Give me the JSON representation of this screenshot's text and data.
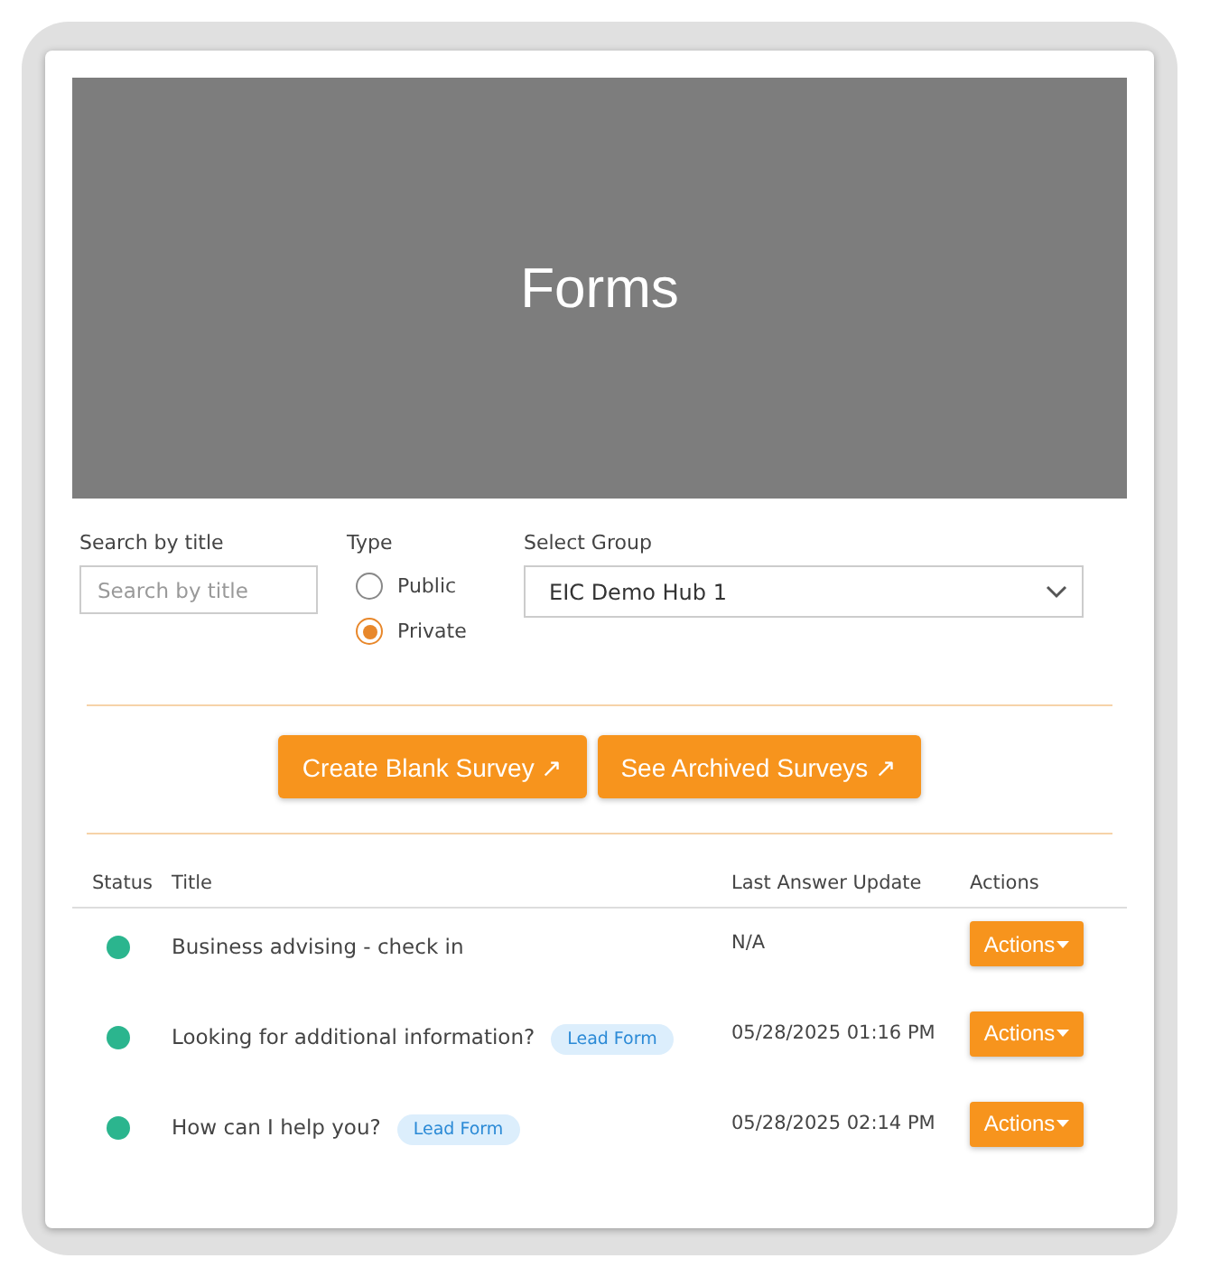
{
  "banner": {
    "title": "Forms"
  },
  "filters": {
    "search": {
      "label": "Search by title",
      "placeholder": "Search by title"
    },
    "type": {
      "label": "Type",
      "options": [
        {
          "label": "Public",
          "selected": false
        },
        {
          "label": "Private",
          "selected": true
        }
      ]
    },
    "group": {
      "label": "Select Group",
      "value": "EIC Demo Hub 1"
    }
  },
  "buttons": [
    "Create Blank Survey ↗",
    "See Archived Surveys ↗"
  ],
  "table": {
    "columns": [
      "Status",
      "Title",
      "Last Answer Update",
      "Actions"
    ],
    "rows": [
      {
        "title": "Business advising - check in",
        "updated": "N/A",
        "action": "Actions"
      },
      {
        "title": "Looking for additional information?",
        "tag": "Lead Form",
        "updated": "05/28/2025 01:16 PM",
        "action": "Actions"
      },
      {
        "title": "How can I help you?",
        "tag": "Lead Form",
        "updated": "05/28/2025 02:14 PM",
        "action": "Actions"
      }
    ]
  }
}
